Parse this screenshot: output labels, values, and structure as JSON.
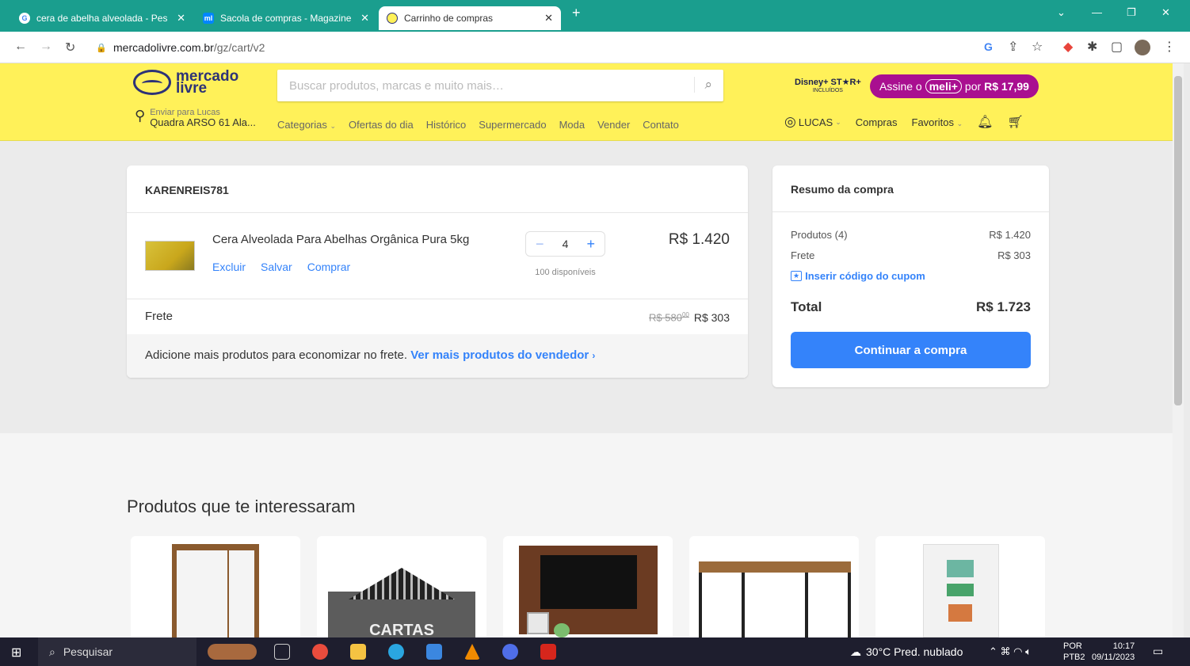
{
  "browser": {
    "tabs": [
      {
        "title": "cera de abelha alveolada - Pesq",
        "favicon": "G"
      },
      {
        "title": "Sacola de compras - Magazine L",
        "favicon": "ml"
      },
      {
        "title": "Carrinho de compras",
        "favicon": ""
      }
    ],
    "url_host": "mercadolivre.com.br",
    "url_path": "/gz/cart/v2"
  },
  "header": {
    "logo_line1": "mercado",
    "logo_line2": "livre",
    "search_placeholder": "Buscar produtos, marcas e muito mais…",
    "disney_text": "Disney+ ST★R+",
    "disney_sub": "INCLUÍDOS",
    "assine_prefix": "Assine o",
    "assine_badge": "meli+",
    "assine_suffix": "por",
    "assine_price": "R$ 17,99",
    "location_line1": "Enviar para Lucas",
    "location_line2": "Quadra ARSO 61 Ala...",
    "nav": [
      "Categorias",
      "Ofertas do dia",
      "Histórico",
      "Supermercado",
      "Moda",
      "Vender",
      "Contato"
    ],
    "user": "LUCAS",
    "user_links": [
      "Compras",
      "Favoritos"
    ]
  },
  "cart": {
    "seller": "KARENREIS781",
    "product_name": "Cera Alveolada Para Abelhas Orgânica Pura 5kg",
    "actions": [
      "Excluir",
      "Salvar",
      "Comprar"
    ],
    "quantity": "4",
    "available": "100 disponíveis",
    "price": "R$ 1.420",
    "shipping_label": "Frete",
    "shipping_old": "R$ 580",
    "shipping_old_cents": "00",
    "shipping_price": "R$ 303",
    "more_text": "Adicione mais produtos para economizar no frete.",
    "more_link": "Ver mais produtos do vendedor"
  },
  "summary": {
    "title": "Resumo da compra",
    "products_label": "Produtos (4)",
    "products_value": "R$ 1.420",
    "shipping_label": "Frete",
    "shipping_value": "R$ 303",
    "coupon": "Inserir código do cupom",
    "total_label": "Total",
    "total_value": "R$ 1.723",
    "cta": "Continuar a compra"
  },
  "recommended": {
    "title": "Produtos que te interessaram",
    "sign_text": "CARTAS"
  },
  "taskbar": {
    "search": "Pesquisar",
    "weather": "30°C  Pred. nublado",
    "lang1": "POR",
    "lang2": "PTB2",
    "time": "10:17",
    "date": "09/11/2023"
  },
  "colors": {
    "brand_yellow": "#fff159",
    "accent_blue": "#3483fa",
    "meli_purple": "#a90f90"
  }
}
